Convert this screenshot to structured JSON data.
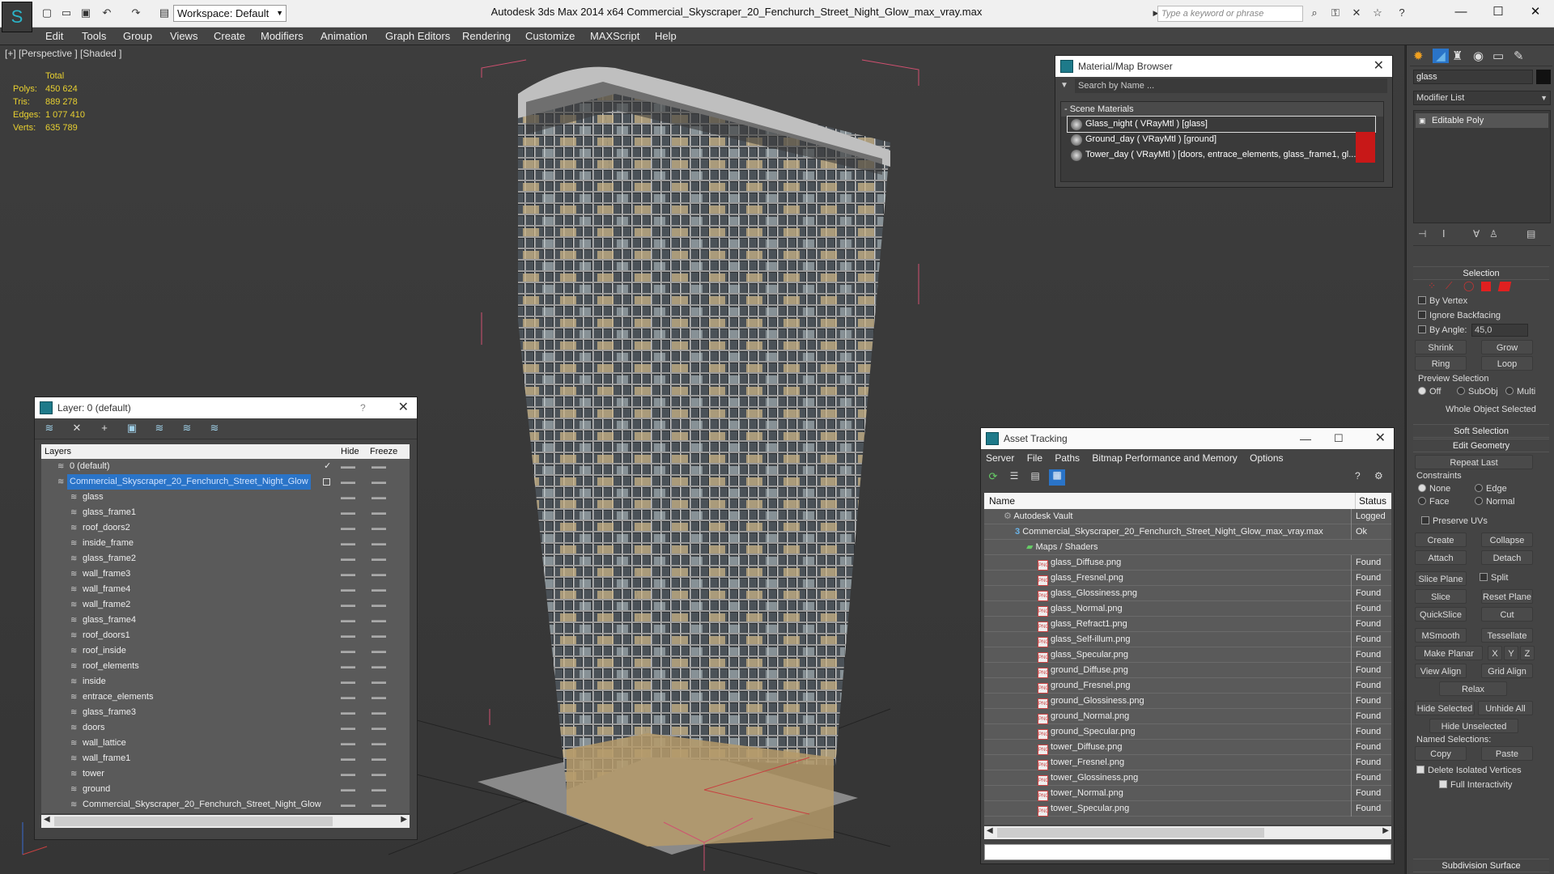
{
  "app": {
    "workspace": "Workspace: Default",
    "title": "Autodesk 3ds Max  2014 x64     Commercial_Skyscraper_20_Fenchurch_Street_Night_Glow_max_vray.max",
    "search_placeholder": "Type a keyword or phrase"
  },
  "menu": [
    "Edit",
    "Tools",
    "Group",
    "Views",
    "Create",
    "Modifiers",
    "Animation",
    "Graph Editors",
    "Rendering",
    "Customize",
    "MAXScript",
    "Help"
  ],
  "viewport": {
    "label": "[+] [Perspective ] [Shaded ]",
    "stats": {
      "total_label": "Total",
      "rows": [
        {
          "label": "Polys:",
          "value": "450 624"
        },
        {
          "label": "Tris:",
          "value": "889 278"
        },
        {
          "label": "Edges:",
          "value": "1 077 410"
        },
        {
          "label": "Verts:",
          "value": "635 789"
        }
      ]
    }
  },
  "layer_panel": {
    "title": "Layer: 0 (default)",
    "help": "?",
    "col_layers": "Layers",
    "col_hide": "Hide",
    "col_freeze": "Freeze",
    "rows": [
      {
        "name": "0 (default)",
        "indent": 0,
        "check": true
      },
      {
        "name": "Commercial_Skyscraper_20_Fenchurch_Street_Night_Glow",
        "indent": 0,
        "selected": true
      },
      {
        "name": "glass",
        "indent": 1
      },
      {
        "name": "glass_frame1",
        "indent": 1
      },
      {
        "name": "roof_doors2",
        "indent": 1
      },
      {
        "name": "inside_frame",
        "indent": 1
      },
      {
        "name": "glass_frame2",
        "indent": 1
      },
      {
        "name": "wall_frame3",
        "indent": 1
      },
      {
        "name": "wall_frame4",
        "indent": 1
      },
      {
        "name": "wall_frame2",
        "indent": 1
      },
      {
        "name": "glass_frame4",
        "indent": 1
      },
      {
        "name": "roof_doors1",
        "indent": 1
      },
      {
        "name": "roof_inside",
        "indent": 1
      },
      {
        "name": "roof_elements",
        "indent": 1
      },
      {
        "name": "inside",
        "indent": 1
      },
      {
        "name": "entrace_elements",
        "indent": 1
      },
      {
        "name": "glass_frame3",
        "indent": 1
      },
      {
        "name": "doors",
        "indent": 1
      },
      {
        "name": "wall_lattice",
        "indent": 1
      },
      {
        "name": "wall_frame1",
        "indent": 1
      },
      {
        "name": "tower",
        "indent": 1
      },
      {
        "name": "ground",
        "indent": 1
      },
      {
        "name": "Commercial_Skyscraper_20_Fenchurch_Street_Night_Glow",
        "indent": 1
      }
    ]
  },
  "material_browser": {
    "title": "Material/Map Browser",
    "search": "Search by Name ...",
    "group": "- Scene Materials",
    "items": [
      {
        "label": "Glass_night  ( VRayMtl ) [glass]",
        "selected": true
      },
      {
        "label": "Ground_day  ( VRayMtl ) [ground]"
      },
      {
        "label": "Tower_day  ( VRayMtl ) [doors, entrace_elements, glass_frame1, gl..."
      }
    ]
  },
  "asset_tracking": {
    "title": "Asset Tracking",
    "menu": [
      "Server",
      "File",
      "Paths",
      "Bitmap Performance and Memory",
      "Options"
    ],
    "col_name": "Name",
    "col_status": "Status",
    "rows": [
      {
        "name": "Autodesk Vault",
        "status": "Logged",
        "indent": 1,
        "type": "vault"
      },
      {
        "name": "Commercial_Skyscraper_20_Fenchurch_Street_Night_Glow_max_vray.max",
        "status": "Ok",
        "indent": 2,
        "type": "max"
      },
      {
        "name": "Maps / Shaders",
        "status": "",
        "indent": 3,
        "type": "folder"
      },
      {
        "name": "glass_Diffuse.png",
        "status": "Found",
        "indent": 4,
        "type": "png"
      },
      {
        "name": "glass_Fresnel.png",
        "status": "Found",
        "indent": 4,
        "type": "png"
      },
      {
        "name": "glass_Glossiness.png",
        "status": "Found",
        "indent": 4,
        "type": "png"
      },
      {
        "name": "glass_Normal.png",
        "status": "Found",
        "indent": 4,
        "type": "png"
      },
      {
        "name": "glass_Refract1.png",
        "status": "Found",
        "indent": 4,
        "type": "png"
      },
      {
        "name": "glass_Self-illum.png",
        "status": "Found",
        "indent": 4,
        "type": "png"
      },
      {
        "name": "glass_Specular.png",
        "status": "Found",
        "indent": 4,
        "type": "png"
      },
      {
        "name": "ground_Diffuse.png",
        "status": "Found",
        "indent": 4,
        "type": "png"
      },
      {
        "name": "ground_Fresnel.png",
        "status": "Found",
        "indent": 4,
        "type": "png"
      },
      {
        "name": "ground_Glossiness.png",
        "status": "Found",
        "indent": 4,
        "type": "png"
      },
      {
        "name": "ground_Normal.png",
        "status": "Found",
        "indent": 4,
        "type": "png"
      },
      {
        "name": "ground_Specular.png",
        "status": "Found",
        "indent": 4,
        "type": "png"
      },
      {
        "name": "tower_Diffuse.png",
        "status": "Found",
        "indent": 4,
        "type": "png"
      },
      {
        "name": "tower_Fresnel.png",
        "status": "Found",
        "indent": 4,
        "type": "png"
      },
      {
        "name": "tower_Glossiness.png",
        "status": "Found",
        "indent": 4,
        "type": "png"
      },
      {
        "name": "tower_Normal.png",
        "status": "Found",
        "indent": 4,
        "type": "png"
      },
      {
        "name": "tower_Specular.png",
        "status": "Found",
        "indent": 4,
        "type": "png"
      }
    ]
  },
  "command_panel": {
    "object_name": "glass",
    "modifier_list": "Modifier List",
    "stack_item": "Editable Poly",
    "selection_hdr": "Selection",
    "by_vertex": "By Vertex",
    "ignore_backfacing": "Ignore Backfacing",
    "by_angle": "By Angle:",
    "by_angle_value": "45,0",
    "shrink": "Shrink",
    "grow": "Grow",
    "ring": "Ring",
    "loop": "Loop",
    "preview_selection": "Preview Selection",
    "off": "Off",
    "subobj": "SubObj",
    "multi": "Multi",
    "whole_object": "Whole Object Selected",
    "soft_selection": "Soft Selection",
    "edit_geometry": "Edit Geometry",
    "repeat_last": "Repeat Last",
    "constraints": "Constraints",
    "none": "None",
    "edge": "Edge",
    "face": "Face",
    "normal": "Normal",
    "preserve_uvs": "Preserve UVs",
    "create": "Create",
    "collapse": "Collapse",
    "attach": "Attach",
    "detach": "Detach",
    "slice_plane": "Slice Plane",
    "split": "Split",
    "slice": "Slice",
    "reset_plane": "Reset Plane",
    "quickslice": "QuickSlice",
    "cut": "Cut",
    "msmooth": "MSmooth",
    "tessellate": "Tessellate",
    "make_planar": "Make Planar",
    "x": "X",
    "y": "Y",
    "z": "Z",
    "view_align": "View Align",
    "grid_align": "Grid Align",
    "relax": "Relax",
    "hide_selected": "Hide Selected",
    "unhide_all": "Unhide All",
    "hide_unselected": "Hide Unselected",
    "named_selections": "Named Selections:",
    "copy": "Copy",
    "paste": "Paste",
    "delete_isolated": "Delete Isolated Vertices",
    "full_interactivity": "Full Interactivity",
    "subdivision_surface": "Subdivision Surface"
  },
  "colors": {
    "accent": "#2a74c8",
    "stats": "#e8d030",
    "selection_box": "#d05070"
  }
}
